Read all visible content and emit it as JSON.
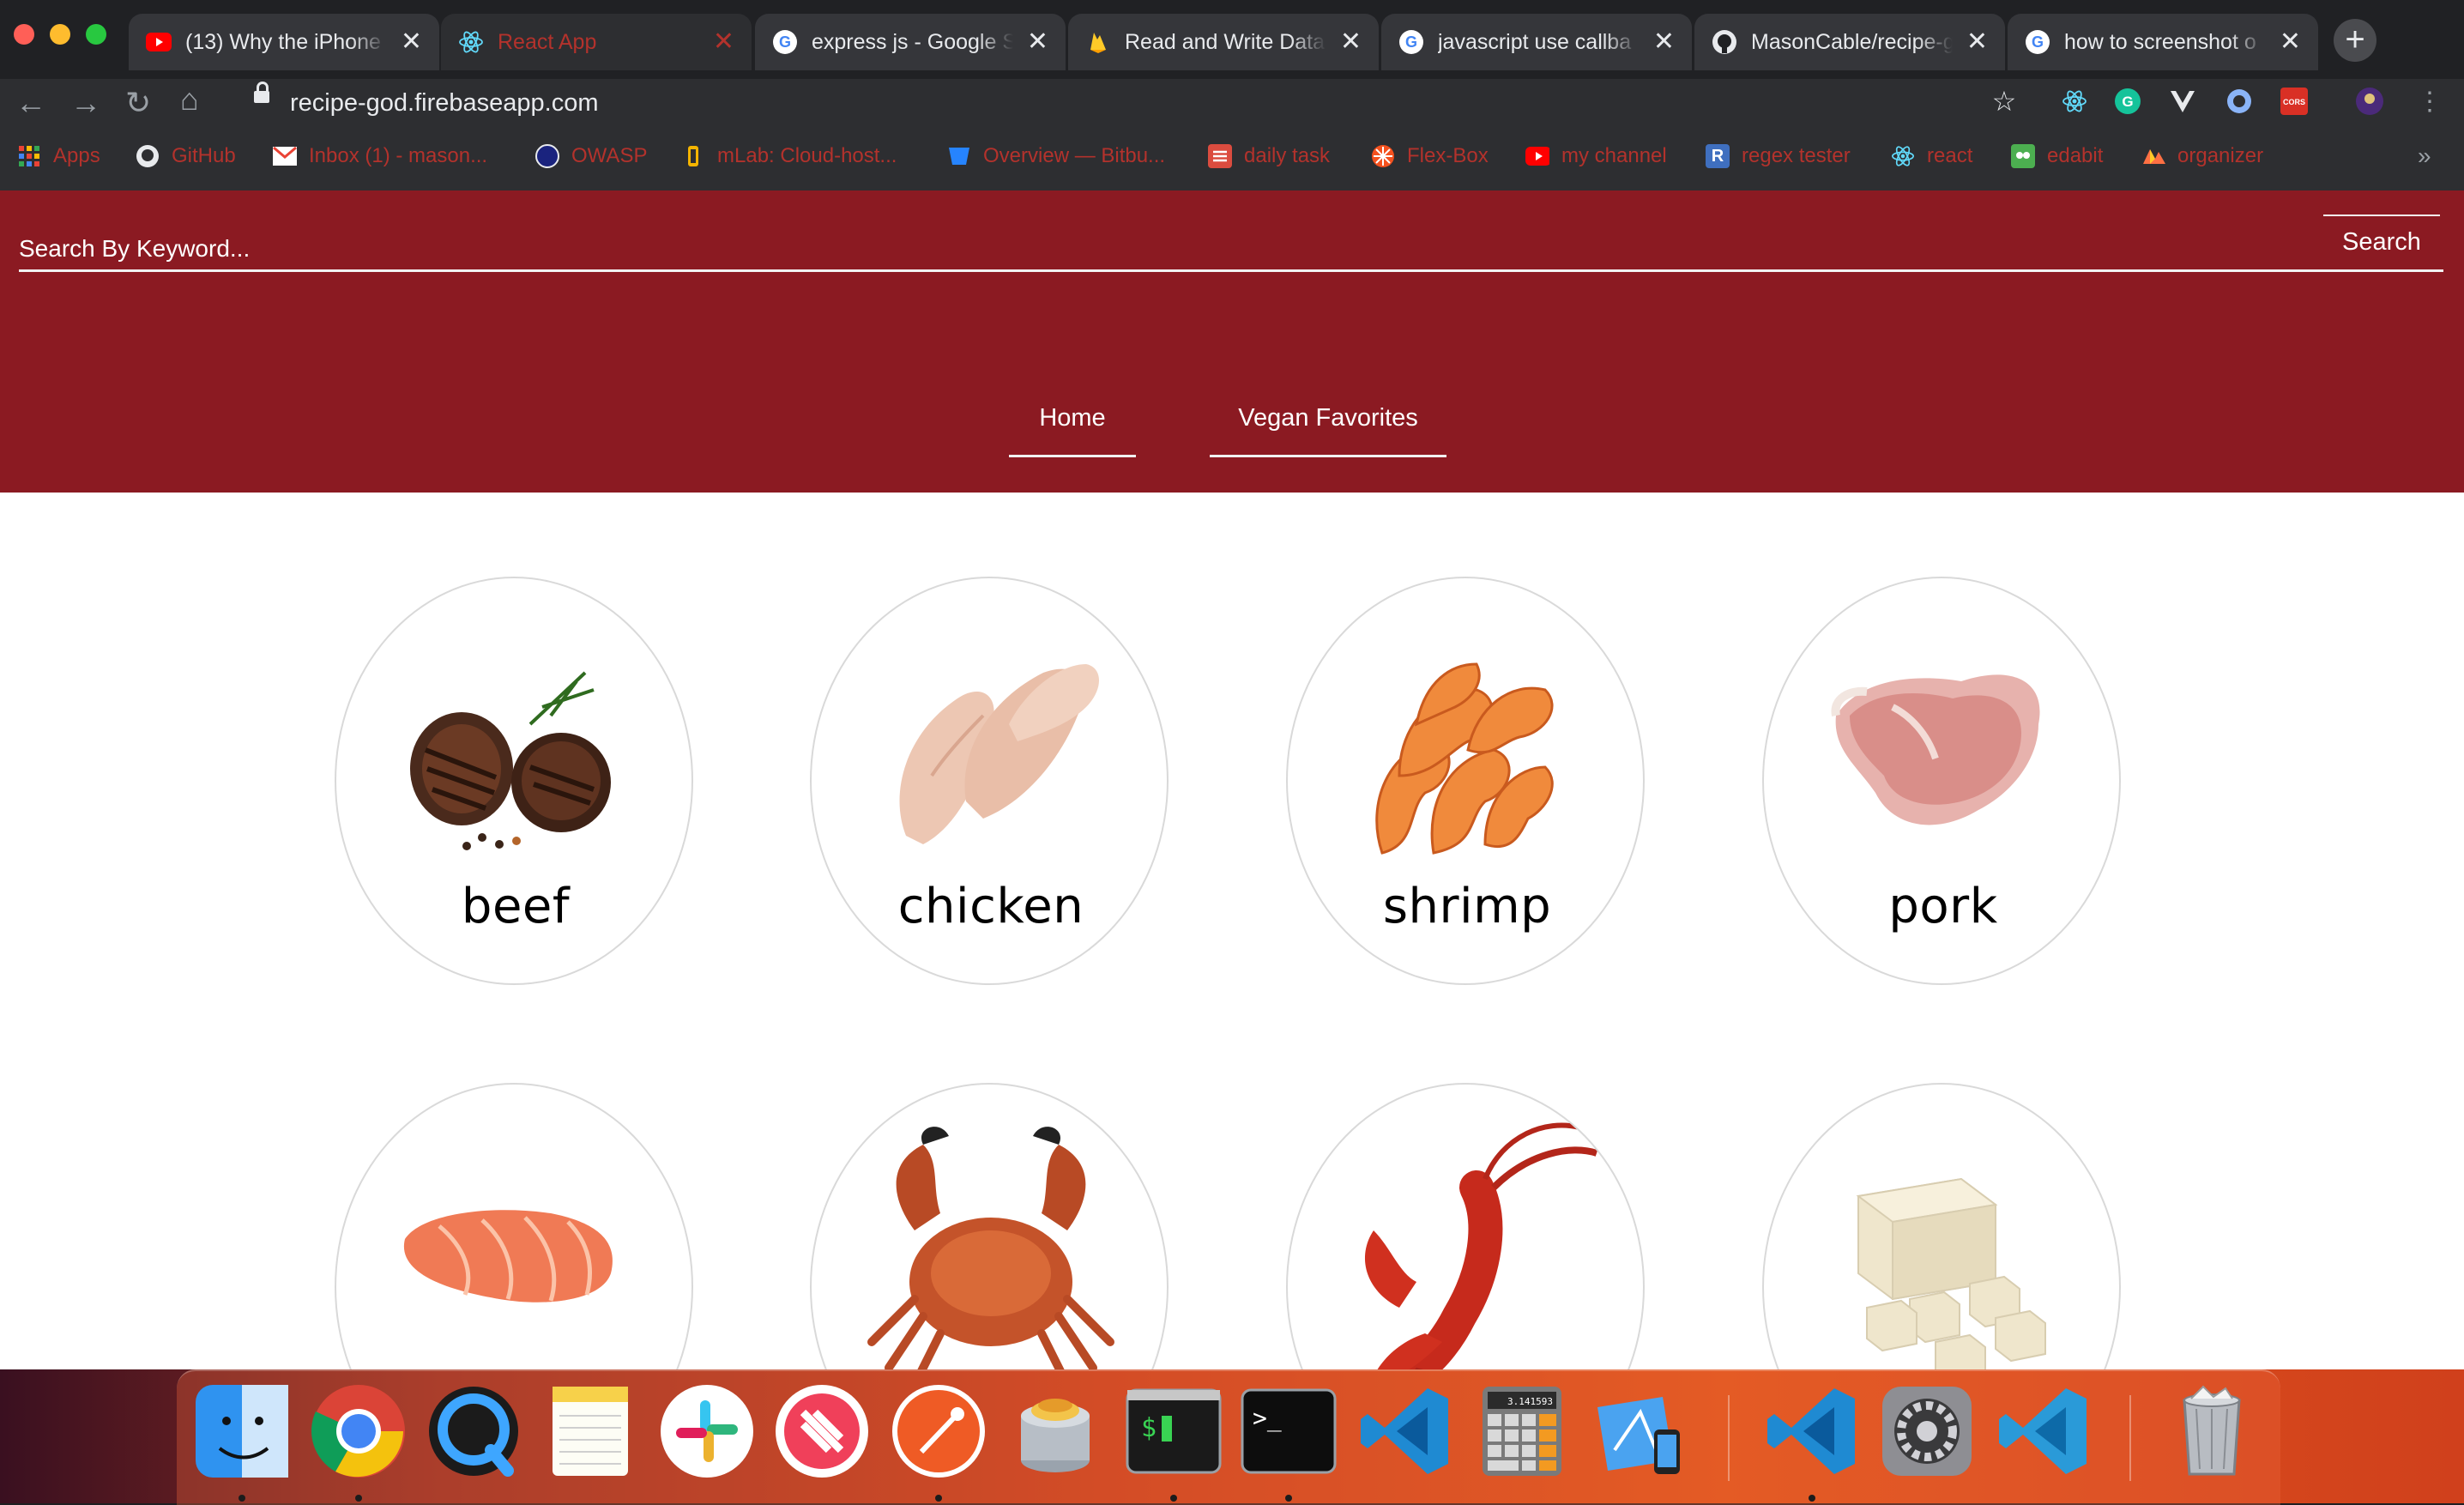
{
  "browser": {
    "tabs": [
      {
        "title": "(13) Why the iPhone",
        "favicon": "youtube-icon",
        "active": false
      },
      {
        "title": "React App",
        "favicon": "react-icon",
        "active": true
      },
      {
        "title": "express js - Google S",
        "favicon": "google-icon",
        "active": false
      },
      {
        "title": "Read and Write Data",
        "favicon": "firebase-icon",
        "active": false
      },
      {
        "title": "javascript use callba",
        "favicon": "google-icon",
        "active": false
      },
      {
        "title": "MasonCable/recipe-g",
        "favicon": "github-icon",
        "active": false
      },
      {
        "title": "how to screenshot o",
        "favicon": "google-icon",
        "active": false
      }
    ],
    "close_glyph": "✕",
    "new_tab_glyph": "+",
    "url": "recipe-god.firebaseapp.com",
    "bookmarks": [
      {
        "label": "Apps",
        "icon": "apps-grid-icon"
      },
      {
        "label": "GitHub",
        "icon": "github-icon"
      },
      {
        "label": "Inbox (1) - mason...",
        "icon": "gmail-icon"
      },
      {
        "label": "OWASP",
        "icon": "owasp-icon"
      },
      {
        "label": "mLab: Cloud-host...",
        "icon": "mlab-icon"
      },
      {
        "label": "Overview — Bitbu...",
        "icon": "bitbucket-icon"
      },
      {
        "label": "daily task",
        "icon": "todoist-icon"
      },
      {
        "label": "Flex-Box",
        "icon": "flexbox-icon"
      },
      {
        "label": "my channel",
        "icon": "youtube-icon"
      },
      {
        "label": "regex tester",
        "icon": "regex-icon"
      },
      {
        "label": "react",
        "icon": "react-icon"
      },
      {
        "label": "edabit",
        "icon": "edabit-icon"
      },
      {
        "label": "organizer",
        "icon": "organizer-icon"
      }
    ],
    "bookmarks_overflow": "»",
    "extension_cors_label": "CORS"
  },
  "page": {
    "search": {
      "placeholder": "Search By Keyword...",
      "button_label": "Search"
    },
    "nav": [
      {
        "label": "Home"
      },
      {
        "label": "Vegan Favorites"
      }
    ],
    "categories": [
      {
        "label": "beef",
        "image": "beef-image"
      },
      {
        "label": "chicken",
        "image": "chicken-image"
      },
      {
        "label": "shrimp",
        "image": "shrimp-image"
      },
      {
        "label": "pork",
        "image": "pork-image"
      },
      {
        "label": "salmon",
        "image": "salmon-image",
        "label_visible": false
      },
      {
        "label": "crab",
        "image": "crab-image",
        "label_visible": false
      },
      {
        "label": "lobster",
        "image": "lobster-image",
        "label_visible": false
      },
      {
        "label": "tofu",
        "image": "tofu-image",
        "label_visible": false
      }
    ],
    "colors": {
      "header": "#8b1a22",
      "accent_text": "#b3322c"
    }
  },
  "dock": {
    "apps": [
      "finder-icon",
      "chrome-icon",
      "quicktime-icon",
      "notes-icon",
      "slack-icon",
      "news-icon",
      "postman-icon",
      "sequel-pro-icon",
      "iterm-icon",
      "terminal-icon",
      "vscode-icon",
      "calculator-icon",
      "simulator-icon",
      "vscode-icon",
      "system-preferences-icon",
      "vscode-insiders-icon",
      "trash-icon"
    ],
    "terminal_prompt": "$",
    "terminal2_prompt": ">_",
    "calculator_display": "3.141593"
  }
}
